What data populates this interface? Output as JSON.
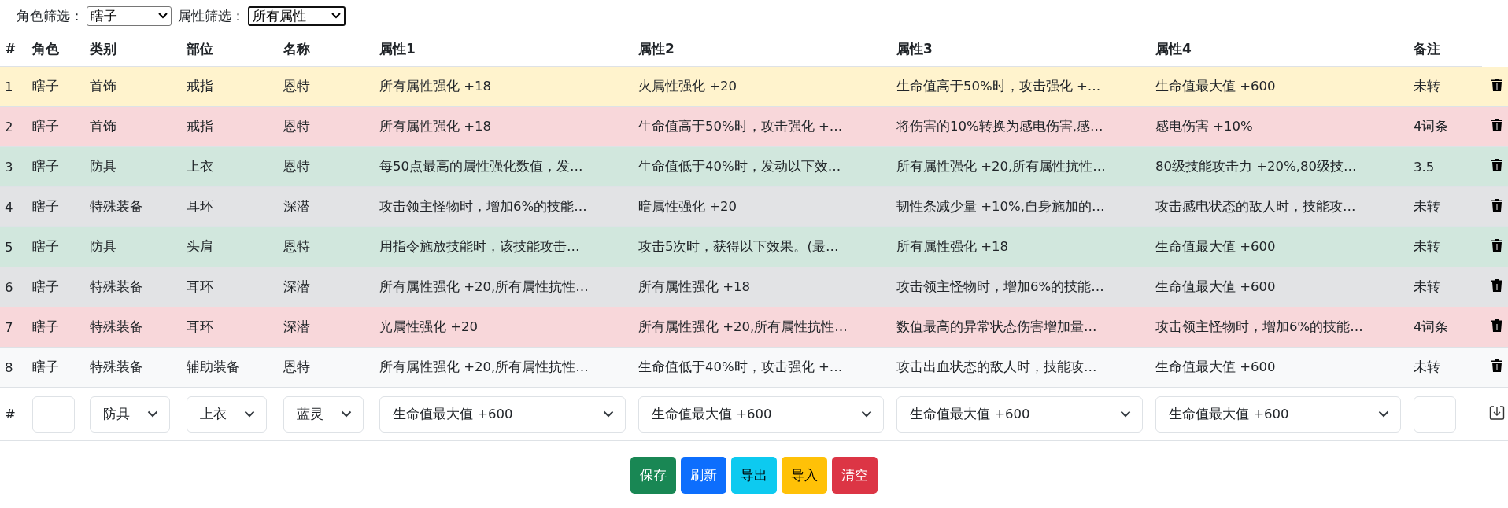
{
  "filters": [
    {
      "label": "角色筛选：",
      "value": "瞎子"
    },
    {
      "label": "属性筛选：",
      "value": "所有属性"
    }
  ],
  "table": {
    "columns": [
      "#",
      "角色",
      "类别",
      "部位",
      "名称",
      "属性1",
      "属性2",
      "属性3",
      "属性4",
      "备注"
    ],
    "rows": [
      {
        "color": "#fff3cd",
        "cells": [
          "1",
          "瞎子",
          "首饰",
          "戒指",
          "恩特",
          "所有属性强化 +18",
          "火属性强化 +20",
          "生命值高于50%时，攻击强化 +…",
          "生命值最大值 +600",
          "未转"
        ]
      },
      {
        "color": "#f8d7da",
        "cells": [
          "2",
          "瞎子",
          "首饰",
          "戒指",
          "恩特",
          "所有属性强化 +18",
          "生命值高于50%时，攻击强化 +…",
          "将伤害的10%转换为感电伤害,感…",
          "感电伤害 +10%",
          "4词条"
        ]
      },
      {
        "color": "#d1e7dd",
        "cells": [
          "3",
          "瞎子",
          "防具",
          "上衣",
          "恩特",
          "每50点最高的属性强化数值，发…",
          "生命值低于40%时，发动以下效…",
          "所有属性强化 +20,所有属性抗性…",
          "80级技能攻击力 +20%,80级技…",
          "3.5"
        ]
      },
      {
        "color": "#e2e3e5",
        "cells": [
          "4",
          "瞎子",
          "特殊装备",
          "耳环",
          "深潜",
          "攻击领主怪物时，增加6%的技能…",
          "暗属性强化 +20",
          "韧性条减少量 +10%,自身施加的…",
          "攻击感电状态的敌人时，技能攻…",
          "未转"
        ]
      },
      {
        "color": "#d1e7dd",
        "cells": [
          "5",
          "瞎子",
          "防具",
          "头肩",
          "恩特",
          "用指令施放技能时，该技能攻击…",
          "攻击5次时，获得以下效果。(最…",
          "所有属性强化 +18",
          "生命值最大值 +600",
          "未转"
        ]
      },
      {
        "color": "#e2e3e5",
        "cells": [
          "6",
          "瞎子",
          "特殊装备",
          "耳环",
          "深潜",
          "所有属性强化 +20,所有属性抗性…",
          "所有属性强化 +18",
          "攻击领主怪物时，增加6%的技能…",
          "生命值最大值 +600",
          "未转"
        ]
      },
      {
        "color": "#f8d7da",
        "cells": [
          "7",
          "瞎子",
          "特殊装备",
          "耳环",
          "深潜",
          "光属性强化 +20",
          "所有属性强化 +20,所有属性抗性…",
          "数值最高的异常状态伤害增加量…",
          "攻击领主怪物时，增加6%的技能…",
          "4词条"
        ]
      },
      {
        "color": "#f8f9fa",
        "cells": [
          "8",
          "瞎子",
          "特殊装备",
          "辅助装备",
          "恩特",
          "所有属性强化 +20,所有属性抗性…",
          "生命值低于40%时，攻击强化 +…",
          "攻击出血状态的敌人时，技能攻…",
          "生命值最大值 +600",
          "未转"
        ]
      }
    ],
    "add_row": {
      "label": "#",
      "selects": [
        "防具",
        "上衣",
        "蓝灵",
        "生命值最大值 +600",
        "生命值最大值 +600",
        "生命值最大值 +600",
        "生命值最大值 +600"
      ]
    }
  },
  "buttons": [
    {
      "label": "保存",
      "kind": "success"
    },
    {
      "label": "刷新",
      "kind": "primary"
    },
    {
      "label": "导出",
      "kind": "info"
    },
    {
      "label": "导入",
      "kind": "warning"
    },
    {
      "label": "清空",
      "kind": "danger"
    }
  ]
}
